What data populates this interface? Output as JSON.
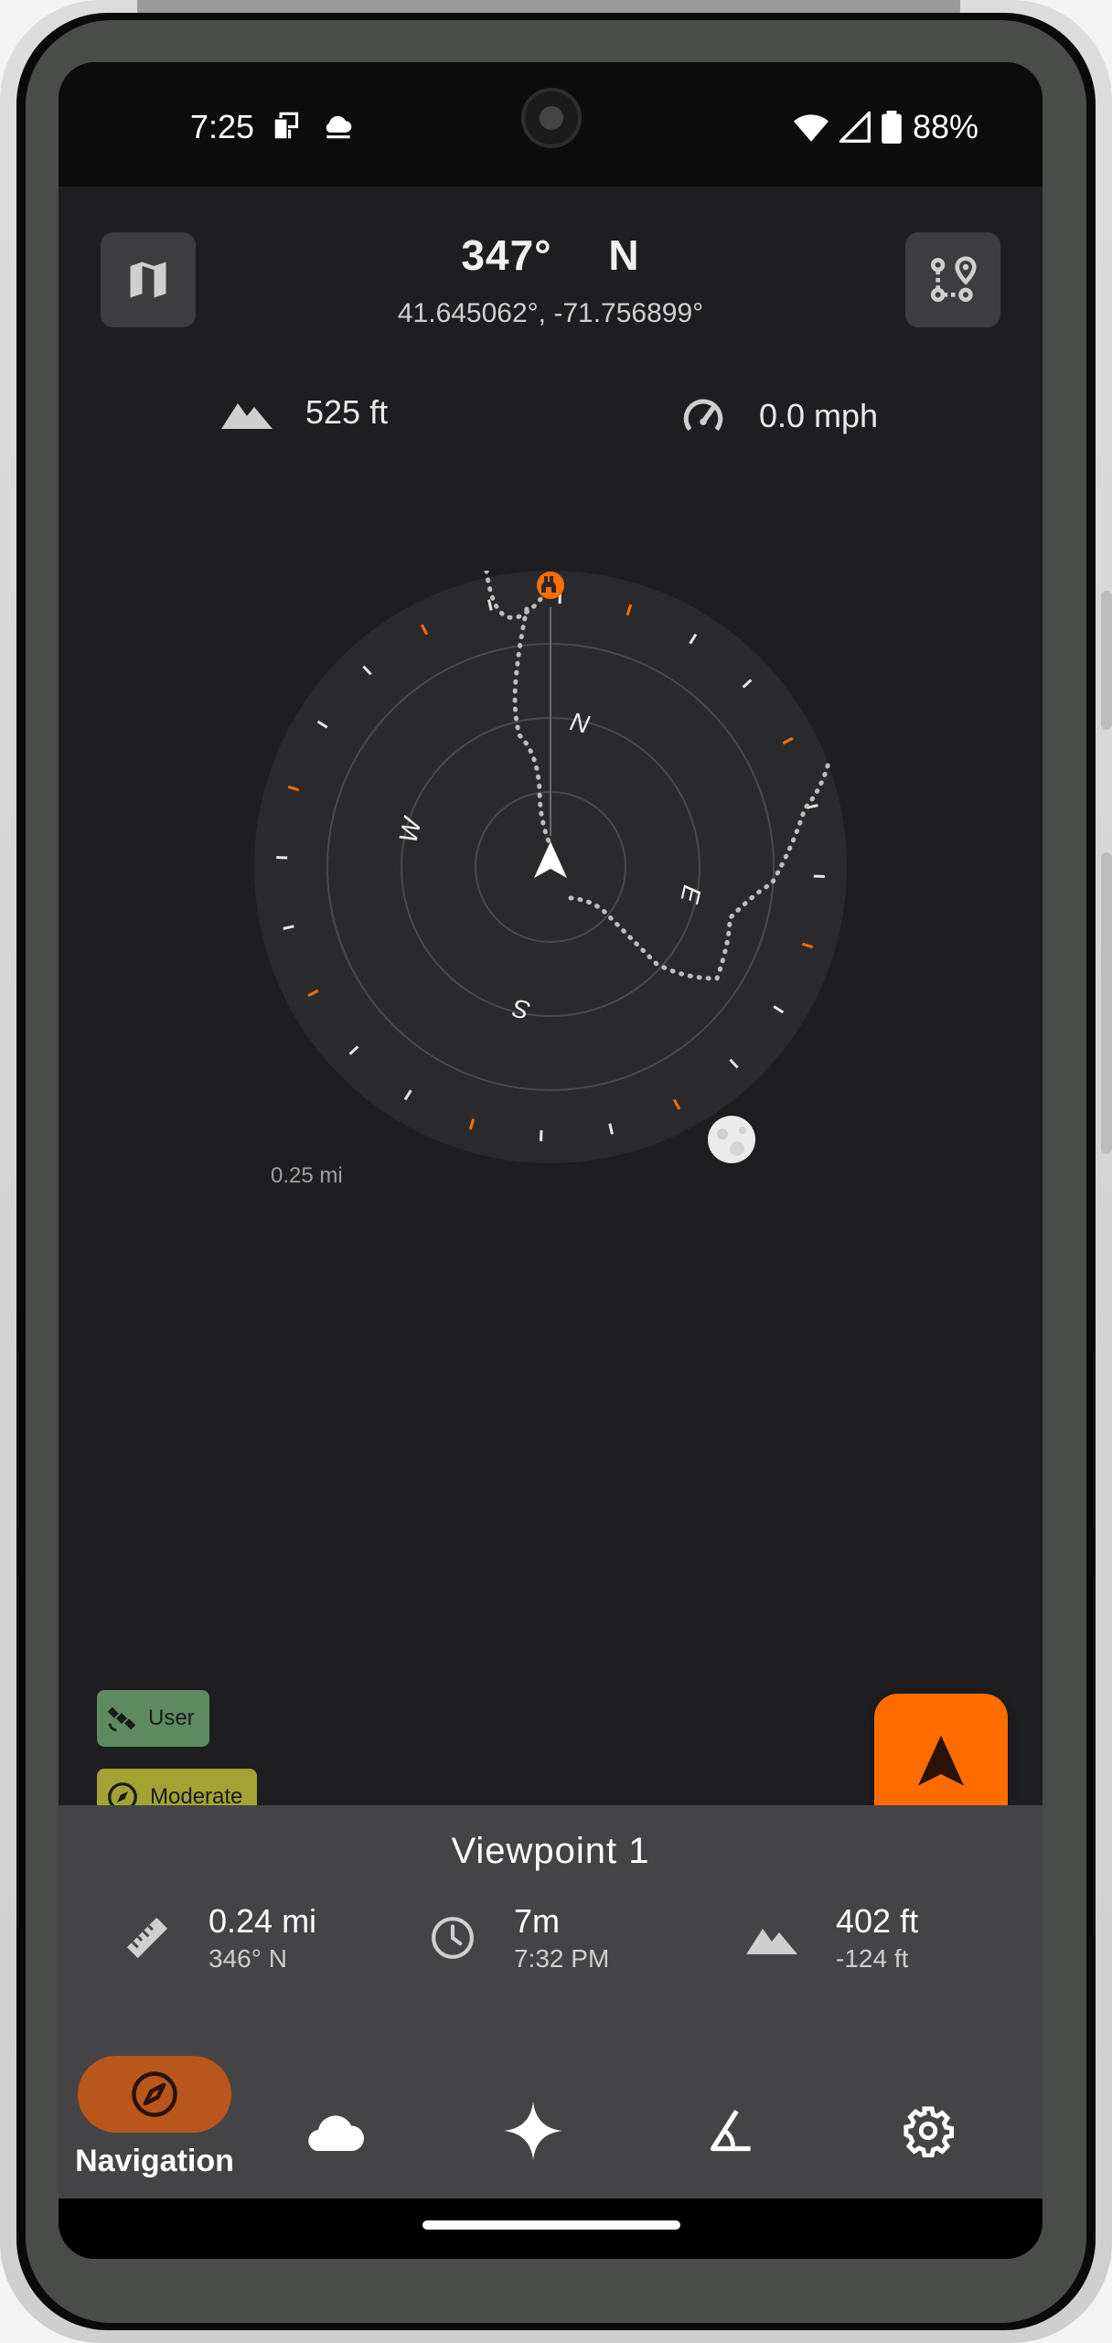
{
  "status_bar": {
    "time": "7:25",
    "battery": "88%",
    "icons": [
      "screen-cast-icon",
      "cloud-icon",
      "wifi-icon",
      "signal-icon",
      "battery-icon"
    ]
  },
  "header": {
    "bearing": "347°",
    "direction": "N",
    "coordinates": "41.645062°,  -71.756899°"
  },
  "stats": {
    "altitude": "525 ft",
    "speed": "0.0 mph"
  },
  "compass": {
    "cardinals": {
      "north": "N",
      "east": "E",
      "south": "S",
      "west": "W"
    },
    "scale": "0.25 mi"
  },
  "badges": {
    "gps": "User",
    "compass_accuracy": "Moderate"
  },
  "destination": {
    "name": "Viewpoint 1",
    "distance": "0.24 mi",
    "bearing": "346° N",
    "duration": "7m",
    "eta": "7:32 PM",
    "elevation": "402 ft",
    "elevation_diff": "-124 ft"
  },
  "nav": {
    "active_label": "Navigation",
    "items": [
      "Navigation",
      "Weather",
      "Astronomy",
      "Tools",
      "Settings"
    ]
  },
  "colors": {
    "accent": "#ff6d00",
    "app_background": "#1e1e20",
    "panel": "#444446",
    "user_badge": "#5d8a60",
    "moderate_badge": "#a4a232"
  }
}
